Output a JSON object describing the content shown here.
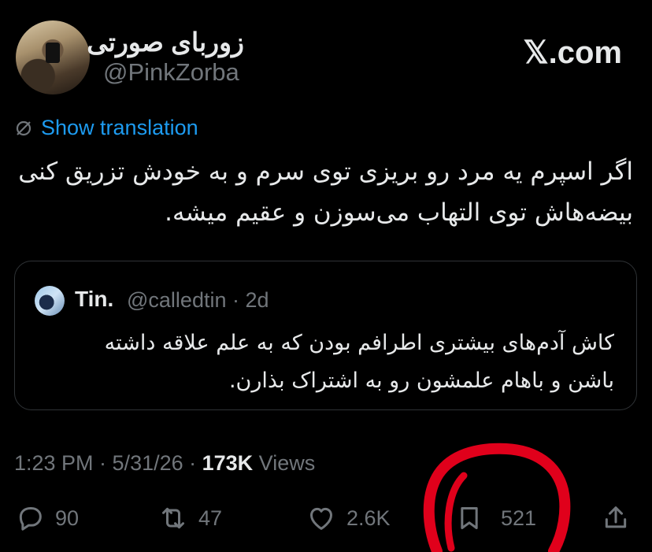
{
  "header": {
    "display_name": "زوربای صورتی",
    "handle": "@PinkZorba",
    "brand": "𝕏.com"
  },
  "translate": {
    "label": "Show translation",
    "icon": "translate-slash-icon"
  },
  "tweet": {
    "lines": [
      "اگر اسپرم یه مرد رو بریزی توی سرم و به خودش تزریق کنی",
      "بیضه‌هاش توی التهاب می‌سوزن و عقیم میشه."
    ]
  },
  "quote": {
    "name": "Tin.",
    "handle_time": "@calledtin · 2d",
    "lines": [
      "کاش آدم‌های بیشتری اطرافم بودن که به علم علاقه داشته",
      "باشن و باهام علمشون رو به اشتراک بذارن."
    ]
  },
  "meta": {
    "time_date": "1:23 PM · 5/31/26 · ",
    "views_count": "173K",
    "views_label": " Views"
  },
  "actions": {
    "replies": "90",
    "reposts": "47",
    "likes": "2.6K",
    "bookmarks": "521"
  },
  "colors": {
    "background": "#000000",
    "text": "#e7e9ea",
    "secondary": "#71767b",
    "link": "#1d9bf0",
    "annotation": "#e0001b"
  }
}
